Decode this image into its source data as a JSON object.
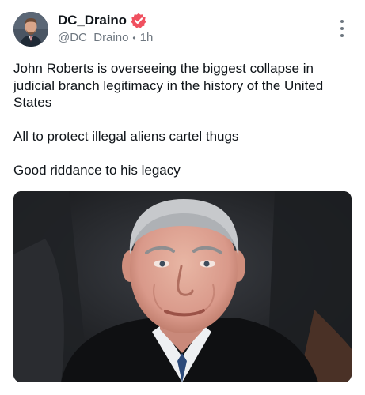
{
  "post": {
    "author": {
      "display_name": "DC_Draino",
      "handle": "@DC_Draino",
      "verified": true,
      "avatar_icon": "avatar-photo"
    },
    "timestamp": "1h",
    "meta_separator": "•",
    "more_icon": "more-vertical-icon",
    "paragraphs": [
      "John Roberts is overseeing the biggest collapse in judicial branch legitimacy in the history of the United States",
      "All to protect illegal aliens cartel thugs",
      "Good riddance to his legacy"
    ],
    "media": {
      "kind": "photo",
      "icon": "portrait-photo"
    }
  },
  "colors": {
    "text": "#0f1419",
    "secondary": "#6e7780",
    "verified_badge": "#f0505f",
    "background": "#ffffff"
  }
}
